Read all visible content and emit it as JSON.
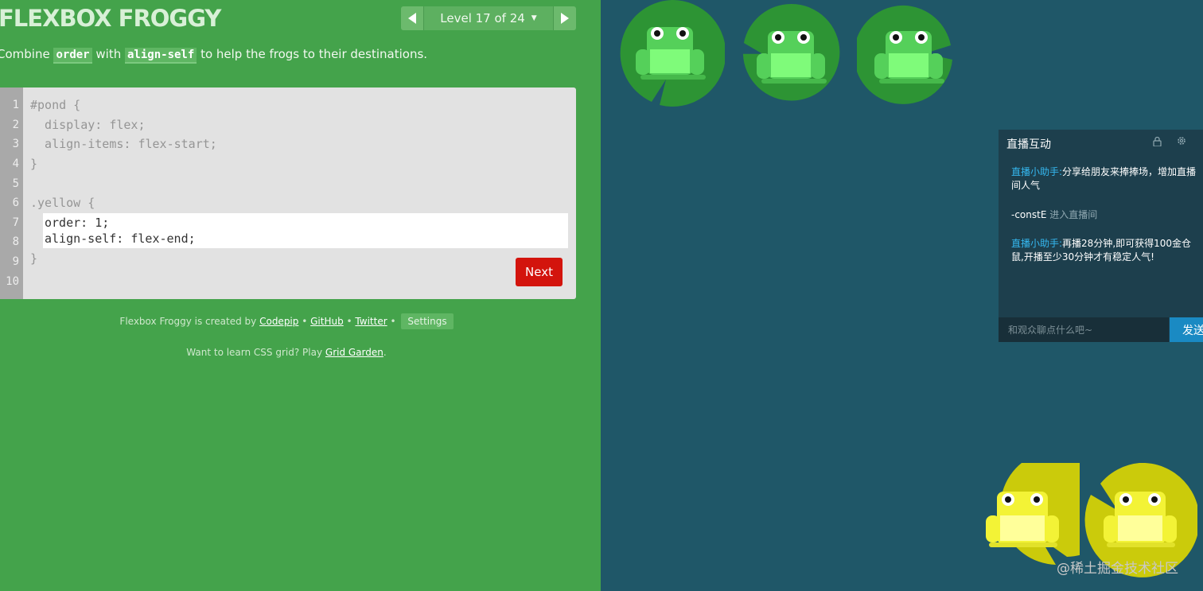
{
  "app": {
    "title": "FLEXBOX FROGGY"
  },
  "level_nav": {
    "label": "Level 17 of 24",
    "caret": "▼"
  },
  "instructions": {
    "prefix": "Combine ",
    "code1": "order",
    "mid": " with ",
    "code2": "align-self",
    "suffix": " to help the frogs to their destinations."
  },
  "editor": {
    "line_numbers": [
      "1",
      "2",
      "3",
      "4",
      "5",
      "6",
      "7",
      "8",
      "9",
      "10"
    ],
    "lines": [
      "#pond {",
      "  display: flex;",
      "  align-items: flex-start;",
      "}",
      "",
      ".yellow {"
    ],
    "input_lines": [
      "order: 1;",
      "align-self: flex-end;"
    ],
    "closing": "}",
    "next_label": "Next"
  },
  "footer": {
    "created_by": "Flexbox Froggy is created by ",
    "codepip": "Codepip",
    "bullet": " • ",
    "github": "GitHub",
    "twitter": "Twitter",
    "settings": "Settings",
    "learn_prefix": "Want to learn CSS grid? Play ",
    "grid_garden": "Grid Garden",
    "learn_suffix": "."
  },
  "pond": {
    "frogs": [
      {
        "color": "green"
      },
      {
        "color": "green"
      },
      {
        "color": "green"
      },
      {
        "color": "yellow"
      },
      {
        "color": "yellow"
      }
    ],
    "colors": {
      "green_pad": "#2d9434",
      "green_frog": "#55d05a",
      "green_belly": "#7ffb7a",
      "yellow_pad": "#cbcb0b",
      "yellow_frog": "#f3f336",
      "yellow_belly": "#ffff9a",
      "water": "#1f5768"
    }
  },
  "chat": {
    "title": "直播互动",
    "lock_icon": "lock-icon",
    "gear_icon": "gear-icon",
    "messages": [
      {
        "who": "直播小助手:",
        "text": "分享给朋友来捧捧场，增加直播间人气"
      },
      {
        "who": "-constE",
        "text": "进入直播间"
      },
      {
        "who": "直播小助手:",
        "text": "再播28分钟,即可获得100金仓鼠,开播至少30分钟才有稳定人气!"
      }
    ],
    "input_placeholder": "和观众聊点什么吧~",
    "send_label": "发送"
  },
  "watermark": "@稀土掘金技术社区"
}
